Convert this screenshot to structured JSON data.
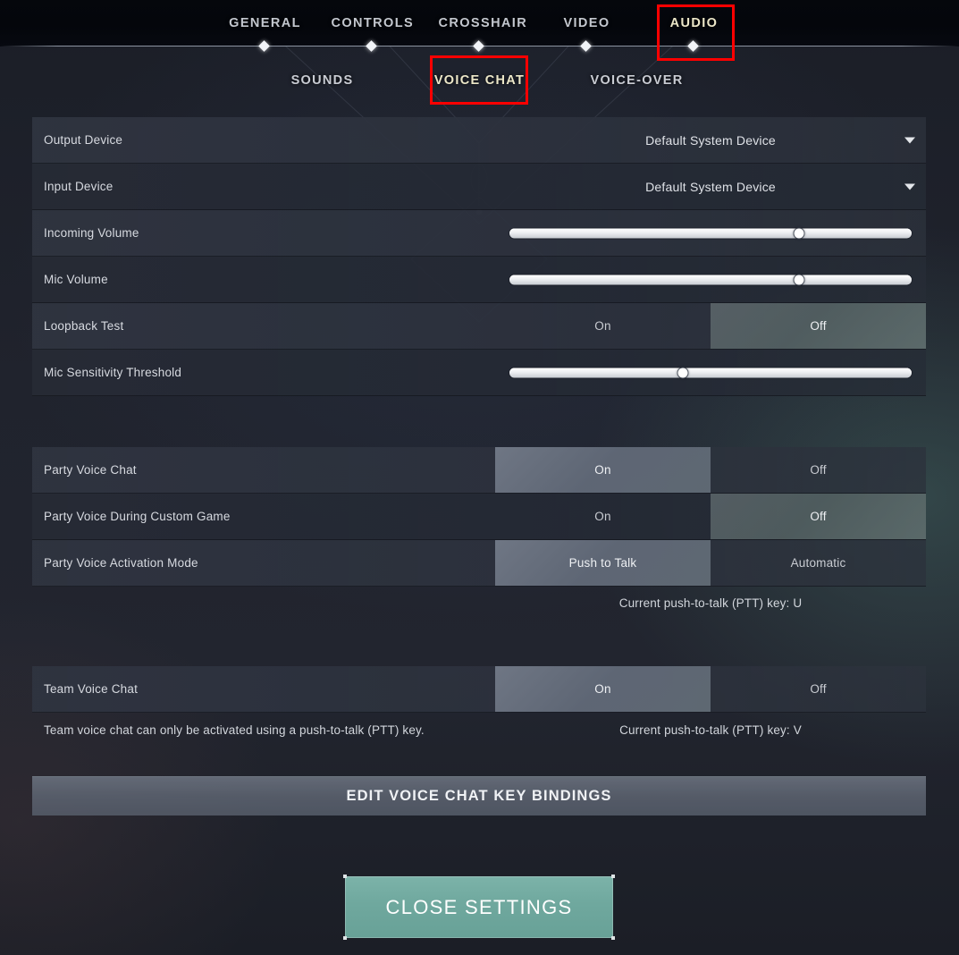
{
  "header": {
    "tabs": [
      {
        "label": "GENERAL",
        "active": false
      },
      {
        "label": "CONTROLS",
        "active": false
      },
      {
        "label": "CROSSHAIR",
        "active": false
      },
      {
        "label": "VIDEO",
        "active": false
      },
      {
        "label": "AUDIO",
        "active": true
      }
    ]
  },
  "subnav": {
    "tabs": [
      {
        "label": "SOUNDS",
        "active": false
      },
      {
        "label": "VOICE CHAT",
        "active": true
      },
      {
        "label": "VOICE-OVER",
        "active": false
      }
    ]
  },
  "annotations": {
    "highlight_color": "#ff0000",
    "boxes": [
      {
        "target": "AUDIO"
      },
      {
        "target": "VOICE CHAT"
      }
    ]
  },
  "settings": {
    "group_devices": [
      {
        "label": "Output Device",
        "type": "dropdown",
        "value": "Default System Device",
        "arrow_icon": "chevron-down-icon"
      },
      {
        "label": "Input Device",
        "type": "dropdown",
        "value": "Default System Device",
        "arrow_icon": "chevron-down-icon"
      },
      {
        "label": "Incoming Volume",
        "type": "slider",
        "percent": 72
      },
      {
        "label": "Mic Volume",
        "type": "slider",
        "percent": 72
      },
      {
        "label": "Loopback Test",
        "type": "toggle",
        "options": [
          "On",
          "Off"
        ],
        "selected": "Off"
      },
      {
        "label": "Mic Sensitivity Threshold",
        "type": "slider",
        "percent": 43
      }
    ],
    "group_party": [
      {
        "label": "Party Voice Chat",
        "type": "toggle",
        "options": [
          "On",
          "Off"
        ],
        "selected": "On"
      },
      {
        "label": "Party Voice During Custom Game",
        "type": "toggle",
        "options": [
          "On",
          "Off"
        ],
        "selected": "Off"
      },
      {
        "label": "Party Voice Activation Mode",
        "type": "toggle",
        "options": [
          "Push to Talk",
          "Automatic"
        ],
        "selected": "Push to Talk"
      }
    ],
    "party_ptt_note": "Current push-to-talk (PTT) key: U",
    "group_team": [
      {
        "label": "Team Voice Chat",
        "type": "toggle",
        "options": [
          "On",
          "Off"
        ],
        "selected": "On"
      }
    ],
    "team_note_left": "Team voice chat can only be activated using a push-to-talk (PTT) key.",
    "team_ptt_note": "Current push-to-talk (PTT) key: V"
  },
  "buttons": {
    "edit_bindings": "EDIT VOICE CHAT KEY BINDINGS",
    "close_settings": "CLOSE SETTINGS",
    "close_settings_color": "#6fa89e"
  }
}
